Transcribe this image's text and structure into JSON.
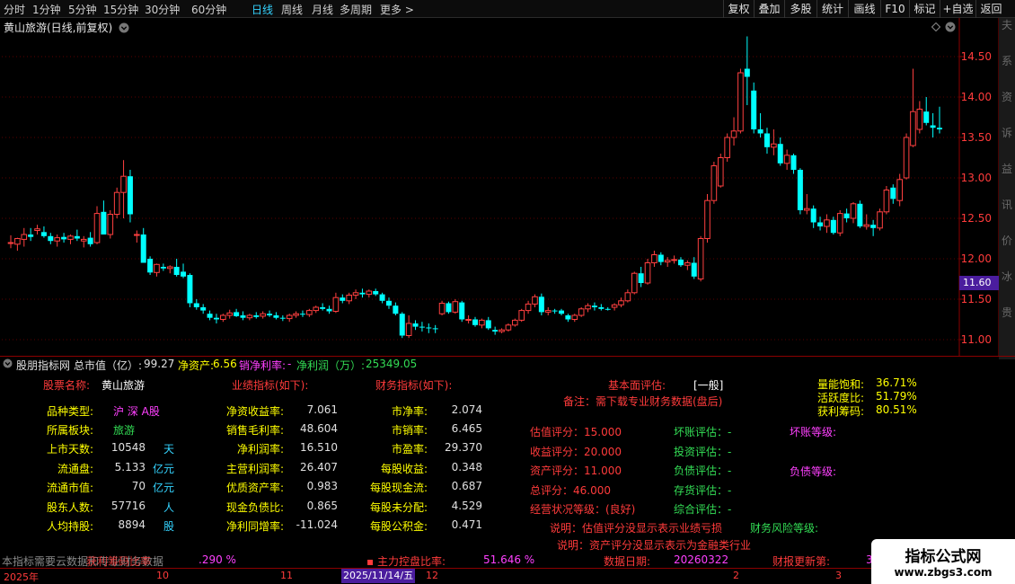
{
  "toolbar": {
    "periods": [
      "分时",
      "1分钟",
      "5分钟",
      "15分钟",
      "30分钟",
      "60分钟",
      "日线",
      "周线",
      "月线",
      "多周期",
      "更多 >"
    ],
    "active_period": "日线",
    "buttons": [
      "复权",
      "叠加",
      "多股",
      "统计",
      "画线",
      "F10",
      "标记",
      "+自选",
      "返回"
    ]
  },
  "chart": {
    "title": "黄山旅游(日线,前复权)",
    "price_axis": [
      "14.50",
      "14.00",
      "13.50",
      "13.00",
      "12.50",
      "12.00",
      "11.50",
      "11.00"
    ],
    "last_price": "11.60",
    "right_strip_text": "夫系资诉益讯价冰贵"
  },
  "chart_data": {
    "type": "candlestick",
    "title": "黄山旅游(日线,前复权)",
    "ylim": [
      10.88,
      14.8
    ],
    "candles": [
      {
        "o": 12.2,
        "h": 12.29,
        "l": 12.13,
        "c": 12.2
      },
      {
        "o": 12.18,
        "h": 12.26,
        "l": 12.1,
        "c": 12.25
      },
      {
        "o": 12.24,
        "h": 12.38,
        "l": 12.15,
        "c": 12.3
      },
      {
        "o": 12.3,
        "h": 12.38,
        "l": 12.22,
        "c": 12.27
      },
      {
        "o": 12.35,
        "h": 12.42,
        "l": 12.3,
        "c": 12.37
      },
      {
        "o": 12.33,
        "h": 12.4,
        "l": 12.26,
        "c": 12.28
      },
      {
        "o": 12.28,
        "h": 12.32,
        "l": 12.18,
        "c": 12.22
      },
      {
        "o": 12.22,
        "h": 12.3,
        "l": 12.15,
        "c": 12.26
      },
      {
        "o": 12.27,
        "h": 12.32,
        "l": 12.2,
        "c": 12.24
      },
      {
        "o": 12.24,
        "h": 12.3,
        "l": 12.18,
        "c": 12.28
      },
      {
        "o": 12.28,
        "h": 12.36,
        "l": 12.22,
        "c": 12.25
      },
      {
        "o": 12.22,
        "h": 12.28,
        "l": 12.14,
        "c": 12.24
      },
      {
        "o": 12.26,
        "h": 12.33,
        "l": 12.15,
        "c": 12.18
      },
      {
        "o": 12.2,
        "h": 12.65,
        "l": 12.18,
        "c": 12.56
      },
      {
        "o": 12.58,
        "h": 12.72,
        "l": 12.4,
        "c": 12.3
      },
      {
        "o": 12.3,
        "h": 12.6,
        "l": 12.25,
        "c": 12.55
      },
      {
        "o": 12.55,
        "h": 12.88,
        "l": 12.5,
        "c": 12.82
      },
      {
        "o": 12.82,
        "h": 13.22,
        "l": 12.5,
        "c": 13.02
      },
      {
        "o": 13.02,
        "h": 13.1,
        "l": 12.45,
        "c": 12.55
      },
      {
        "o": 12.3,
        "h": 12.35,
        "l": 12.2,
        "c": 12.3
      },
      {
        "o": 12.3,
        "h": 12.38,
        "l": 11.95,
        "c": 11.95
      },
      {
        "o": 12.0,
        "h": 12.03,
        "l": 11.8,
        "c": 11.83
      },
      {
        "o": 11.83,
        "h": 11.94,
        "l": 11.78,
        "c": 11.93
      },
      {
        "o": 11.9,
        "h": 11.94,
        "l": 11.85,
        "c": 11.88
      },
      {
        "o": 11.88,
        "h": 11.92,
        "l": 11.82,
        "c": 11.9
      },
      {
        "o": 11.9,
        "h": 12.0,
        "l": 11.78,
        "c": 11.8
      },
      {
        "o": 11.84,
        "h": 11.94,
        "l": 11.76,
        "c": 11.78
      },
      {
        "o": 11.8,
        "h": 11.82,
        "l": 11.4,
        "c": 11.45
      },
      {
        "o": 11.45,
        "h": 11.5,
        "l": 11.37,
        "c": 11.4
      },
      {
        "o": 11.4,
        "h": 11.44,
        "l": 11.32,
        "c": 11.36
      },
      {
        "o": 11.32,
        "h": 11.36,
        "l": 11.24,
        "c": 11.27
      },
      {
        "o": 11.27,
        "h": 11.32,
        "l": 11.2,
        "c": 11.25
      },
      {
        "o": 11.25,
        "h": 11.32,
        "l": 11.22,
        "c": 11.3
      },
      {
        "o": 11.3,
        "h": 11.37,
        "l": 11.26,
        "c": 11.33
      },
      {
        "o": 11.34,
        "h": 11.38,
        "l": 11.28,
        "c": 11.29
      },
      {
        "o": 11.3,
        "h": 11.35,
        "l": 11.24,
        "c": 11.27
      },
      {
        "o": 11.27,
        "h": 11.32,
        "l": 11.24,
        "c": 11.3
      },
      {
        "o": 11.3,
        "h": 11.34,
        "l": 11.26,
        "c": 11.28
      },
      {
        "o": 11.29,
        "h": 11.35,
        "l": 11.26,
        "c": 11.32
      },
      {
        "o": 11.32,
        "h": 11.36,
        "l": 11.28,
        "c": 11.3
      },
      {
        "o": 11.3,
        "h": 11.34,
        "l": 11.25,
        "c": 11.27
      },
      {
        "o": 11.27,
        "h": 11.3,
        "l": 11.23,
        "c": 11.26
      },
      {
        "o": 11.26,
        "h": 11.32,
        "l": 11.22,
        "c": 11.3
      },
      {
        "o": 11.3,
        "h": 11.35,
        "l": 11.27,
        "c": 11.32
      },
      {
        "o": 11.32,
        "h": 11.36,
        "l": 11.28,
        "c": 11.31
      },
      {
        "o": 11.31,
        "h": 11.38,
        "l": 11.28,
        "c": 11.36
      },
      {
        "o": 11.36,
        "h": 11.42,
        "l": 11.33,
        "c": 11.4
      },
      {
        "o": 11.4,
        "h": 11.45,
        "l": 11.36,
        "c": 11.38
      },
      {
        "o": 11.38,
        "h": 11.42,
        "l": 11.32,
        "c": 11.35
      },
      {
        "o": 11.35,
        "h": 11.58,
        "l": 11.33,
        "c": 11.52
      },
      {
        "o": 11.52,
        "h": 11.56,
        "l": 11.45,
        "c": 11.48
      },
      {
        "o": 11.48,
        "h": 11.58,
        "l": 11.44,
        "c": 11.55
      },
      {
        "o": 11.55,
        "h": 11.62,
        "l": 11.5,
        "c": 11.58
      },
      {
        "o": 11.58,
        "h": 11.63,
        "l": 11.52,
        "c": 11.56
      },
      {
        "o": 11.56,
        "h": 11.62,
        "l": 11.52,
        "c": 11.6
      },
      {
        "o": 11.6,
        "h": 11.63,
        "l": 11.54,
        "c": 11.56
      },
      {
        "o": 11.56,
        "h": 11.58,
        "l": 11.45,
        "c": 11.48
      },
      {
        "o": 11.48,
        "h": 11.52,
        "l": 11.38,
        "c": 11.42
      },
      {
        "o": 11.42,
        "h": 11.46,
        "l": 11.3,
        "c": 11.32
      },
      {
        "o": 11.32,
        "h": 11.34,
        "l": 11.02,
        "c": 11.05
      },
      {
        "o": 11.05,
        "h": 11.3,
        "l": 11.02,
        "c": 11.2
      },
      {
        "o": 11.2,
        "h": 11.24,
        "l": 11.12,
        "c": 11.16
      },
      {
        "o": 11.16,
        "h": 11.22,
        "l": 11.1,
        "c": 11.15
      },
      {
        "o": 11.15,
        "h": 11.2,
        "l": 11.08,
        "c": 11.14
      },
      {
        "o": 11.14,
        "h": 11.18,
        "l": 11.08,
        "c": 11.13
      },
      {
        "o": 11.32,
        "h": 11.48,
        "l": 11.3,
        "c": 11.45
      },
      {
        "o": 11.45,
        "h": 11.47,
        "l": 11.32,
        "c": 11.34
      },
      {
        "o": 11.34,
        "h": 11.5,
        "l": 11.32,
        "c": 11.47
      },
      {
        "o": 11.46,
        "h": 11.48,
        "l": 11.22,
        "c": 11.25
      },
      {
        "o": 11.25,
        "h": 11.3,
        "l": 11.2,
        "c": 11.25
      },
      {
        "o": 11.25,
        "h": 11.28,
        "l": 11.16,
        "c": 11.18
      },
      {
        "o": 11.18,
        "h": 11.26,
        "l": 11.14,
        "c": 11.24
      },
      {
        "o": 11.24,
        "h": 11.28,
        "l": 11.12,
        "c": 11.14
      },
      {
        "o": 11.12,
        "h": 11.16,
        "l": 11.06,
        "c": 11.1
      },
      {
        "o": 11.1,
        "h": 11.14,
        "l": 11.08,
        "c": 11.12
      },
      {
        "o": 11.12,
        "h": 11.2,
        "l": 11.1,
        "c": 11.18
      },
      {
        "o": 11.18,
        "h": 11.26,
        "l": 11.16,
        "c": 11.24
      },
      {
        "o": 11.24,
        "h": 11.38,
        "l": 11.22,
        "c": 11.36
      },
      {
        "o": 11.36,
        "h": 11.48,
        "l": 11.32,
        "c": 11.44
      },
      {
        "o": 11.44,
        "h": 11.56,
        "l": 11.4,
        "c": 11.53
      },
      {
        "o": 11.53,
        "h": 11.57,
        "l": 11.3,
        "c": 11.34
      },
      {
        "o": 11.34,
        "h": 11.4,
        "l": 11.3,
        "c": 11.36
      },
      {
        "o": 11.36,
        "h": 11.38,
        "l": 11.32,
        "c": 11.35
      },
      {
        "o": 11.36,
        "h": 11.38,
        "l": 11.3,
        "c": 11.32
      },
      {
        "o": 11.3,
        "h": 11.32,
        "l": 11.22,
        "c": 11.25
      },
      {
        "o": 11.25,
        "h": 11.32,
        "l": 11.22,
        "c": 11.3
      },
      {
        "o": 11.3,
        "h": 11.4,
        "l": 11.28,
        "c": 11.38
      },
      {
        "o": 11.38,
        "h": 11.45,
        "l": 11.34,
        "c": 11.42
      },
      {
        "o": 11.42,
        "h": 11.46,
        "l": 11.36,
        "c": 11.4
      },
      {
        "o": 11.4,
        "h": 11.44,
        "l": 11.36,
        "c": 11.38
      },
      {
        "o": 11.38,
        "h": 11.4,
        "l": 11.36,
        "c": 11.37
      },
      {
        "o": 11.4,
        "h": 11.45,
        "l": 11.36,
        "c": 11.43
      },
      {
        "o": 11.43,
        "h": 11.52,
        "l": 11.4,
        "c": 11.48
      },
      {
        "o": 11.48,
        "h": 11.62,
        "l": 11.46,
        "c": 11.58
      },
      {
        "o": 11.58,
        "h": 11.84,
        "l": 11.56,
        "c": 11.82
      },
      {
        "o": 11.82,
        "h": 11.9,
        "l": 11.65,
        "c": 11.7
      },
      {
        "o": 11.7,
        "h": 12.0,
        "l": 11.68,
        "c": 11.95
      },
      {
        "o": 11.95,
        "h": 12.1,
        "l": 11.9,
        "c": 12.05
      },
      {
        "o": 12.05,
        "h": 12.08,
        "l": 11.92,
        "c": 11.96
      },
      {
        "o": 11.96,
        "h": 12.02,
        "l": 11.9,
        "c": 11.98
      },
      {
        "o": 11.98,
        "h": 12.04,
        "l": 11.94,
        "c": 11.99
      },
      {
        "o": 11.99,
        "h": 12.02,
        "l": 11.9,
        "c": 11.92
      },
      {
        "o": 11.92,
        "h": 11.98,
        "l": 11.86,
        "c": 11.95
      },
      {
        "o": 11.95,
        "h": 12.02,
        "l": 11.75,
        "c": 11.78
      },
      {
        "o": 11.75,
        "h": 12.28,
        "l": 11.72,
        "c": 12.25
      },
      {
        "o": 12.25,
        "h": 12.8,
        "l": 12.2,
        "c": 12.72
      },
      {
        "o": 12.72,
        "h": 13.2,
        "l": 12.68,
        "c": 13.15
      },
      {
        "o": 12.9,
        "h": 13.3,
        "l": 12.88,
        "c": 13.25
      },
      {
        "o": 13.25,
        "h": 13.55,
        "l": 13.2,
        "c": 13.5
      },
      {
        "o": 13.5,
        "h": 13.75,
        "l": 13.4,
        "c": 13.58
      },
      {
        "o": 13.58,
        "h": 14.35,
        "l": 13.55,
        "c": 14.3
      },
      {
        "o": 14.35,
        "h": 14.75,
        "l": 13.9,
        "c": 14.25
      },
      {
        "o": 14.08,
        "h": 14.18,
        "l": 13.55,
        "c": 13.6
      },
      {
        "o": 13.6,
        "h": 13.8,
        "l": 13.5,
        "c": 13.55
      },
      {
        "o": 13.55,
        "h": 13.62,
        "l": 13.3,
        "c": 13.38
      },
      {
        "o": 13.38,
        "h": 13.6,
        "l": 13.28,
        "c": 13.42
      },
      {
        "o": 13.42,
        "h": 13.5,
        "l": 13.15,
        "c": 13.18
      },
      {
        "o": 13.18,
        "h": 13.35,
        "l": 13.1,
        "c": 13.28
      },
      {
        "o": 13.28,
        "h": 13.3,
        "l": 13.05,
        "c": 13.1
      },
      {
        "o": 13.1,
        "h": 13.12,
        "l": 12.55,
        "c": 12.6
      },
      {
        "o": 12.6,
        "h": 12.8,
        "l": 12.55,
        "c": 12.62
      },
      {
        "o": 12.62,
        "h": 12.66,
        "l": 12.38,
        "c": 12.45
      },
      {
        "o": 12.45,
        "h": 12.52,
        "l": 12.35,
        "c": 12.4
      },
      {
        "o": 12.4,
        "h": 12.55,
        "l": 12.32,
        "c": 12.48
      },
      {
        "o": 12.48,
        "h": 12.52,
        "l": 12.3,
        "c": 12.32
      },
      {
        "o": 12.32,
        "h": 12.6,
        "l": 12.28,
        "c": 12.56
      },
      {
        "o": 12.56,
        "h": 12.62,
        "l": 12.45,
        "c": 12.5
      },
      {
        "o": 12.5,
        "h": 12.7,
        "l": 12.44,
        "c": 12.68
      },
      {
        "o": 12.68,
        "h": 12.72,
        "l": 12.38,
        "c": 12.4
      },
      {
        "o": 12.4,
        "h": 12.55,
        "l": 12.36,
        "c": 12.42
      },
      {
        "o": 12.42,
        "h": 12.48,
        "l": 12.28,
        "c": 12.38
      },
      {
        "o": 12.38,
        "h": 12.62,
        "l": 12.35,
        "c": 12.58
      },
      {
        "o": 12.58,
        "h": 12.9,
        "l": 12.55,
        "c": 12.85
      },
      {
        "o": 12.88,
        "h": 12.92,
        "l": 12.68,
        "c": 12.74
      },
      {
        "o": 12.72,
        "h": 13.05,
        "l": 12.65,
        "c": 12.98
      },
      {
        "o": 13.0,
        "h": 13.55,
        "l": 12.98,
        "c": 13.5
      },
      {
        "o": 13.4,
        "h": 14.35,
        "l": 13.38,
        "c": 13.82
      },
      {
        "o": 13.6,
        "h": 13.95,
        "l": 13.55,
        "c": 13.85
      },
      {
        "o": 13.82,
        "h": 14.0,
        "l": 13.65,
        "c": 13.68
      },
      {
        "o": 13.65,
        "h": 13.8,
        "l": 13.5,
        "c": 13.62
      },
      {
        "o": 13.62,
        "h": 13.88,
        "l": 13.55,
        "c": 13.6
      }
    ]
  },
  "fin": {
    "header_title": "股朋指标网",
    "mv_label": "总市值（亿）:",
    "mv_value": "99.27",
    "na_label": "净资产:",
    "na_value": "6.56",
    "nm_label": "销净利率:",
    "nm_value": "-",
    "np_label": "净利润（万）:",
    "np_value": "25349.05",
    "stock_name_label": "股票名称:",
    "stock_name": "黄山旅游",
    "perf_header": "业绩指标(如下):",
    "fin_header": "财务指标(如下):",
    "left": [
      {
        "label": "品种类型:",
        "value": "沪 深 A股",
        "unit": ""
      },
      {
        "label": "所属板块:",
        "value": "旅游",
        "unit": ""
      },
      {
        "label": "上市天数:",
        "value": "10548",
        "unit": "天"
      },
      {
        "label": "流通盘:",
        "value": "5.133",
        "unit": "亿元"
      },
      {
        "label": "流通市值:",
        "value": "70",
        "unit": "亿元"
      },
      {
        "label": "股东人数:",
        "value": "57716",
        "unit": "人"
      },
      {
        "label": "人均持股:",
        "value": "8894",
        "unit": "股"
      }
    ],
    "perf": [
      {
        "label": "净资收益率:",
        "value": "7.061"
      },
      {
        "label": "销售毛利率:",
        "value": "48.604"
      },
      {
        "label": "净利润率:",
        "value": "16.510"
      },
      {
        "label": "主营利润率:",
        "value": "26.407"
      },
      {
        "label": "优质资产率:",
        "value": "0.983"
      },
      {
        "label": "现金负债比:",
        "value": "0.865"
      },
      {
        "label": "净利同增率:",
        "value": "-11.024"
      }
    ],
    "fin": [
      {
        "label": "市净率:",
        "value": "2.074"
      },
      {
        "label": "市销率:",
        "value": "6.465"
      },
      {
        "label": "市盈率:",
        "value": "29.370"
      },
      {
        "label": "每股收益:",
        "value": "0.348"
      },
      {
        "label": "每股现金流:",
        "value": "0.687"
      },
      {
        "label": "每股未分配:",
        "value": "4.529"
      },
      {
        "label": "每股公积金:",
        "value": "0.471"
      }
    ],
    "fund_label": "基本面评估:",
    "fund_value": "[一般]",
    "note": "备注：需下载专业财务数据(盘后)",
    "scores": [
      "估值评分：15.000",
      "收益评分：20.000",
      "资产评分：11.000",
      "总评分：46.000",
      "经营状况等级：(良好)"
    ],
    "evals": [
      "坏账评估：-",
      "投资评估：-",
      "负债评估：-",
      "存货评估：-",
      "综合评估：-"
    ],
    "bad_debt_level": "坏账等级:",
    "debt_level": "负债等级:",
    "expl1": "说明：估值评分没显示表示业绩亏损",
    "risk_level": "财务风险等级:",
    "expl2": "说明：资产评分没显示表示为金融类行业",
    "vol_sat_label": "量能饱和:",
    "vol_sat": "36.71%",
    "activity_label": "活跃度比:",
    "activity": "51.79%",
    "profit_chip_label": "获利筹码:",
    "profit_chip": "80.51%",
    "footer_note": "本指标需要云数据和专业财务数据",
    "footer_mid": "获利筹码比率",
    "footer_pct": ".290  %",
    "control_label": "主力控盘比率:",
    "control_value": "51.646  %",
    "data_date_label": "数据日期:",
    "data_date": "20260322",
    "report_update_label": "财报更新第:",
    "report_update_value": "3"
  },
  "timebar": {
    "year": "2025年",
    "m10": "10",
    "m11": "11",
    "cursor_date": "2025/11/14/五",
    "m12": "12",
    "m2": "2",
    "m3": "3"
  },
  "watermark": {
    "line1": "指标公式网",
    "line2": "www.zbgs3.com"
  },
  "colors": {
    "up": "#ff4040",
    "down": "#00ffff",
    "label": "#ffff00",
    "accent": "#34d3ff",
    "magenta": "#ff40ff",
    "green": "#33dd55"
  }
}
